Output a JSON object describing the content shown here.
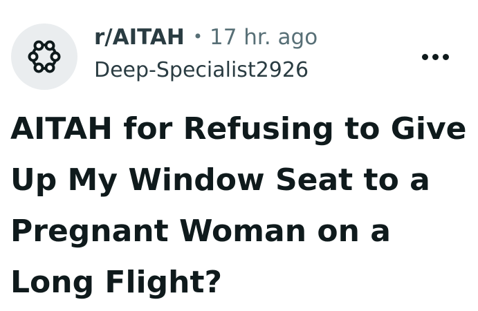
{
  "post": {
    "subreddit": "r/AITAH",
    "separator": "•",
    "time_ago": "17 hr. ago",
    "author": "Deep-Specialist2926",
    "title": "AITAH for Refusing to Give Up My Window Seat to a Pregnant Woman on a Long Flight?",
    "avatar_icon": "community-ring-icon",
    "more_icon": "more-options-icon"
  },
  "colors": {
    "avatar_bg": "#eaedef",
    "text_primary": "#0f1a1c",
    "text_secondary": "#576f76"
  }
}
